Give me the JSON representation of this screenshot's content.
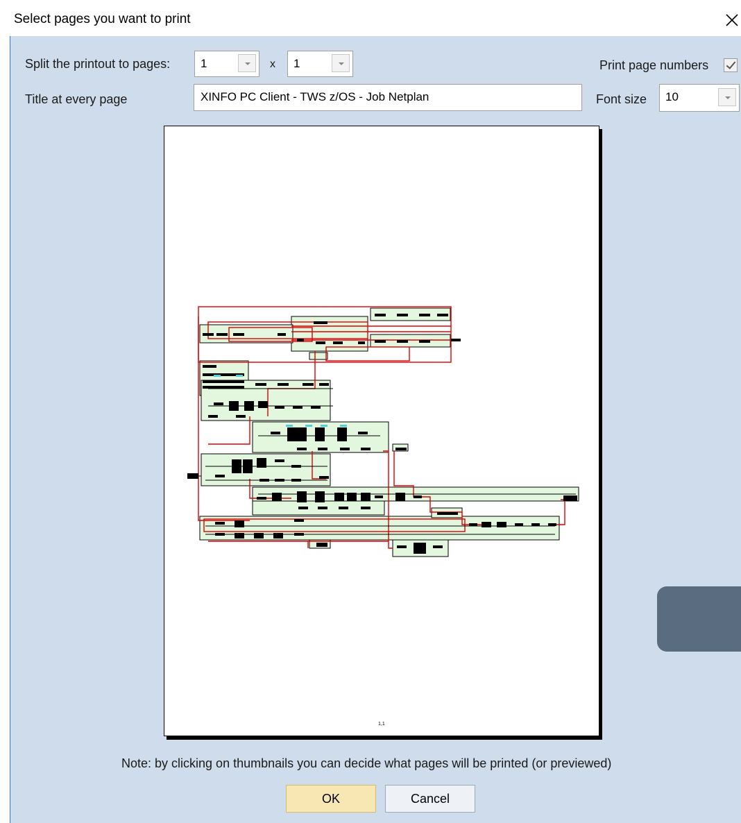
{
  "window": {
    "title": "Select pages you want to print"
  },
  "split": {
    "label": "Split the printout to pages:",
    "cols": "1",
    "times": "x",
    "rows": "1"
  },
  "page_numbers": {
    "label": "Print page numbers",
    "checked": true
  },
  "title_row": {
    "label": "Title at every page",
    "value": "XINFO PC Client - TWS z/OS - Job Netplan"
  },
  "font_size": {
    "label": "Font size",
    "value": "10"
  },
  "preview": {
    "page_label": "1,1"
  },
  "note": "Note: by clicking on thumbnails you can decide what pages will be printed (or previewed)",
  "buttons": {
    "ok": "OK",
    "cancel": "Cancel"
  },
  "colors": {
    "accent": "#2f7dd4",
    "client_bg": "#cfdcec",
    "diagram_group_fill": "#e3f6de",
    "dependency_line": "#e00000"
  }
}
